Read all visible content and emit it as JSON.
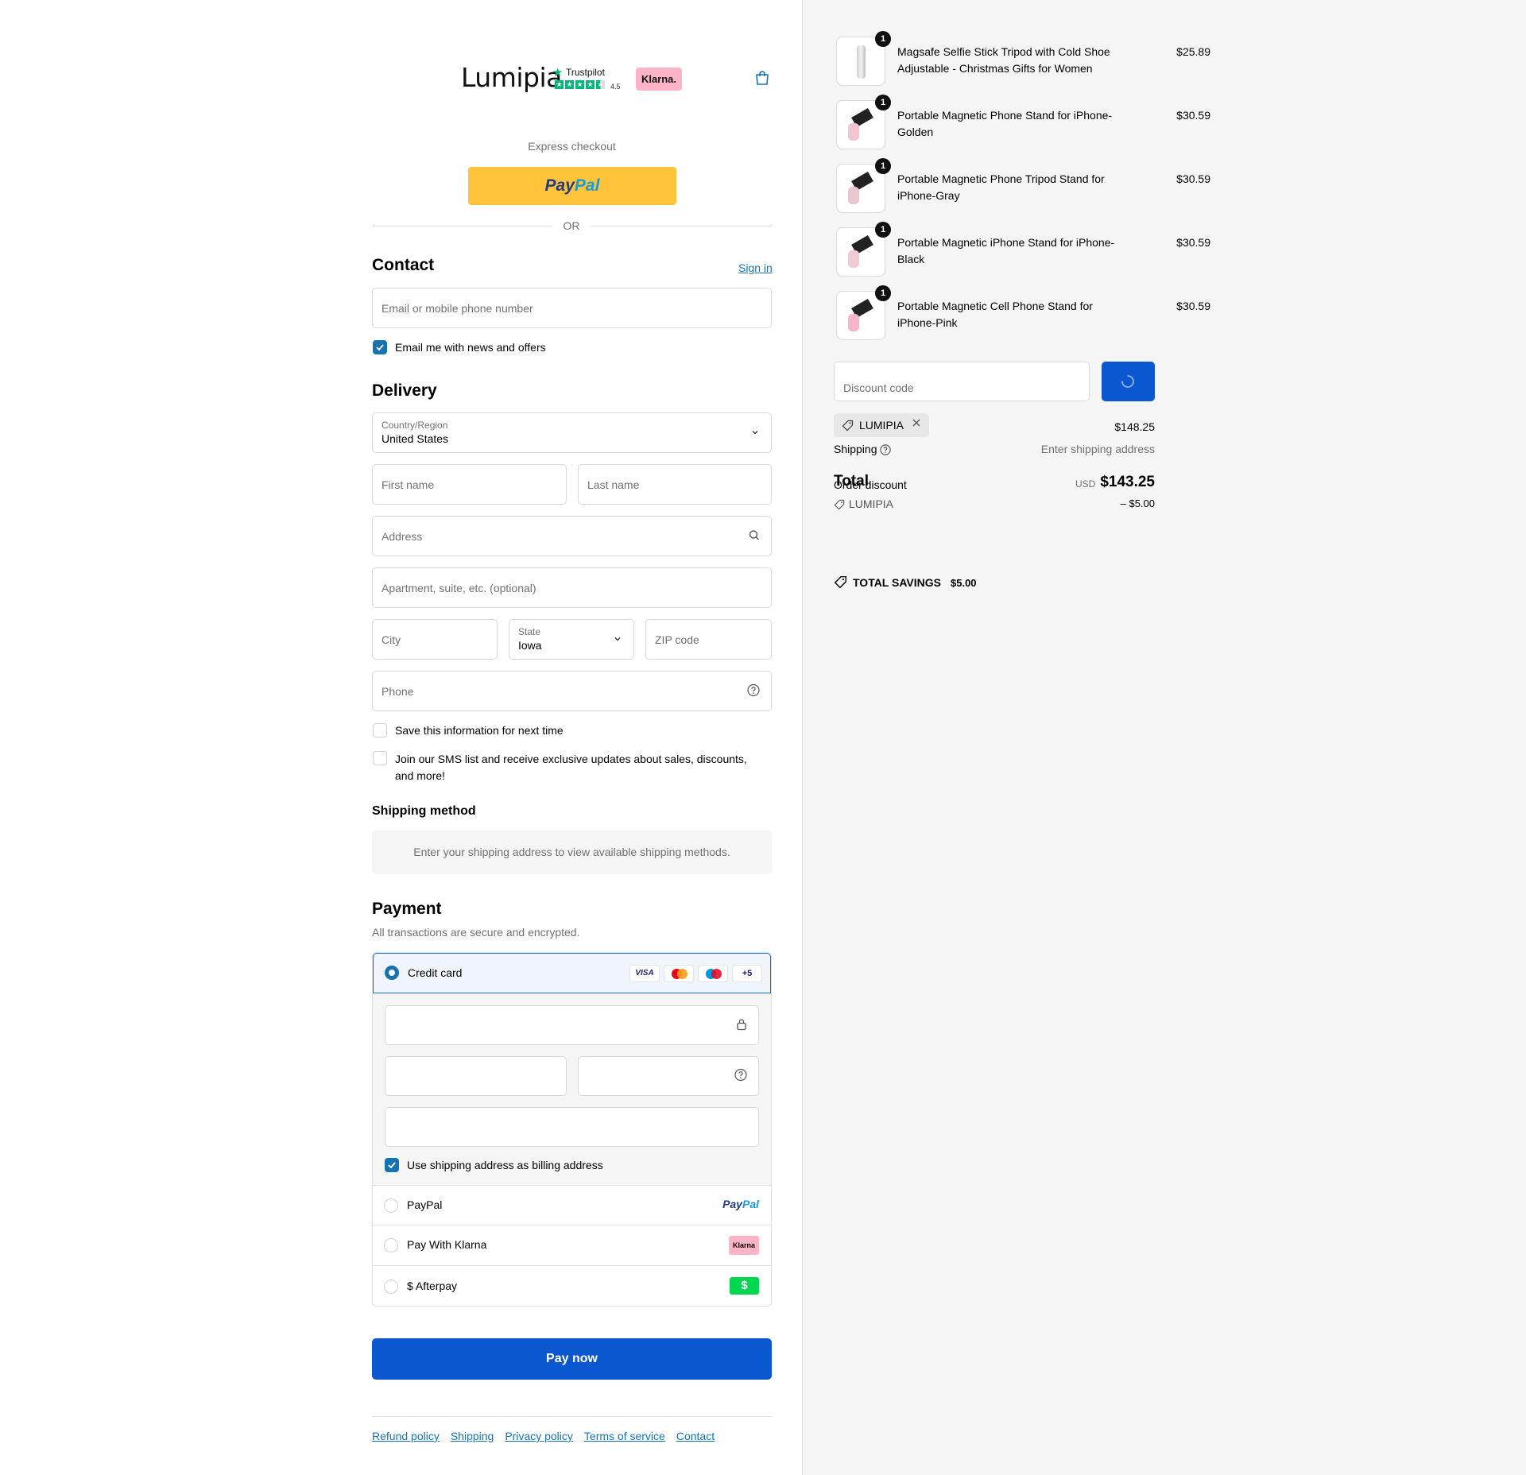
{
  "header": {
    "logo": "Lumipia",
    "trustpilot_label": "Trustpilot",
    "trustpilot_score": "4.5",
    "klarna_label": "Klarna."
  },
  "express": {
    "title": "Express checkout",
    "paypal_label": "PayPal",
    "or": "OR"
  },
  "contact": {
    "title": "Contact",
    "sign_in": "Sign in",
    "email_placeholder": "Email or mobile phone number",
    "newsletter_label": "Email me with news and offers",
    "newsletter_checked": true
  },
  "delivery": {
    "title": "Delivery",
    "country_label": "Country/Region",
    "country_value": "United States",
    "first_name": "First name",
    "last_name": "Last name",
    "address": "Address",
    "apartment": "Apartment, suite, etc. (optional)",
    "city": "City",
    "state_label": "State",
    "state_value": "Iowa",
    "zip": "ZIP code",
    "phone": "Phone",
    "save_info": "Save this information for next time",
    "sms_optin": "Join our SMS list and receive exclusive updates about sales, discounts, and more!"
  },
  "shipping_method": {
    "title": "Shipping method",
    "message": "Enter your shipping address to view available shipping methods."
  },
  "payment": {
    "title": "Payment",
    "subtitle": "All transactions are secure and encrypted.",
    "credit_card": "Credit card",
    "card_brands": [
      "VISA",
      "mastercard",
      "maestro"
    ],
    "more_brands": "+5",
    "billing_same": "Use shipping address as billing address",
    "options": [
      {
        "label": "PayPal",
        "logo": "PayPal"
      },
      {
        "label": "Pay With Klarna",
        "logo": "Klarna"
      },
      {
        "label": "$ Afterpay",
        "logo": "$"
      }
    ],
    "pay_now": "Pay now"
  },
  "footer": {
    "links": [
      "Refund policy",
      "Shipping",
      "Privacy policy",
      "Terms of service",
      "Contact"
    ]
  },
  "cart": {
    "items": [
      {
        "name": "Magsafe Selfie Stick Tripod with Cold Shoe Adjustable - Christmas Gifts for Women",
        "qty": "1",
        "price": "$25.89"
      },
      {
        "name": "Portable Magnetic Phone Stand for iPhone-Golden",
        "qty": "1",
        "price": "$30.59"
      },
      {
        "name": "Portable Magnetic Phone Tripod Stand for iPhone-Gray",
        "qty": "1",
        "price": "$30.59"
      },
      {
        "name": "Portable Magnetic iPhone Stand for iPhone-Black",
        "qty": "1",
        "price": "$30.59"
      },
      {
        "name": "Portable Magnetic Cell Phone Stand for iPhone-Pink",
        "qty": "1",
        "price": "$30.59"
      }
    ],
    "discount_placeholder": "Discount code",
    "applied_code": "LUMIPIA",
    "subtotal_value": "$148.25",
    "shipping_label": "Shipping",
    "shipping_value": "Enter shipping address",
    "order_discount_label": "Order discount",
    "total_label": "Total",
    "total_currency": "USD",
    "total_value": "$143.25",
    "discount_code": "LUMIPIA",
    "discount_value": "– $5.00",
    "savings_label": "TOTAL SAVINGS",
    "savings_value": "$5.00"
  },
  "colors": {
    "accent": "#1773b0",
    "button": "#0b57d0",
    "paypal_yellow": "#ffc439"
  }
}
